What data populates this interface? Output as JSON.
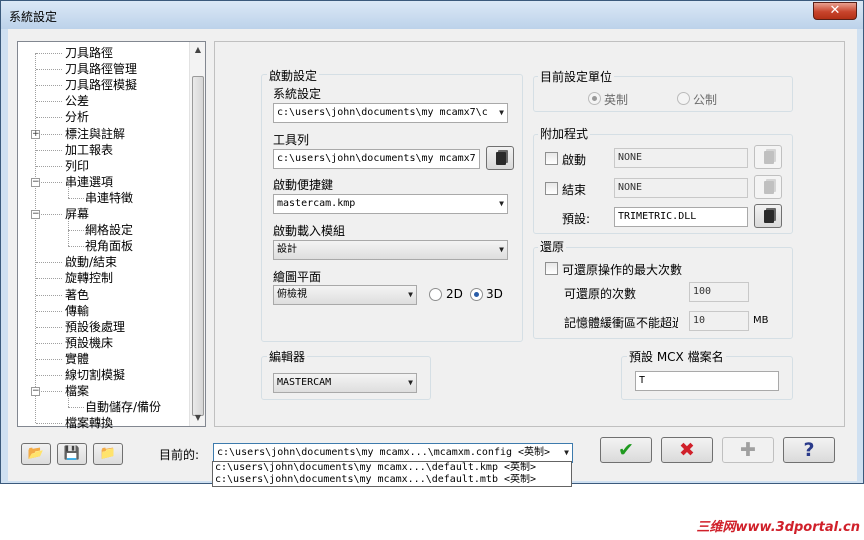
{
  "window": {
    "title": "系統設定",
    "close_glyph": "✕"
  },
  "tree": {
    "items": [
      {
        "label": "刀具路徑",
        "level": 0
      },
      {
        "label": "刀具路徑管理",
        "level": 0
      },
      {
        "label": "刀具路徑模擬",
        "level": 0
      },
      {
        "label": "公差",
        "level": 0
      },
      {
        "label": "分析",
        "level": 0
      },
      {
        "label": "標注與註解",
        "level": 0,
        "expander": "+"
      },
      {
        "label": "加工報表",
        "level": 0
      },
      {
        "label": "列印",
        "level": 0
      },
      {
        "label": "串連選項",
        "level": 0,
        "expander": "−"
      },
      {
        "label": "串連特徵",
        "level": 1
      },
      {
        "label": "屏幕",
        "level": 0,
        "expander": "−"
      },
      {
        "label": "網格設定",
        "level": 1
      },
      {
        "label": "視角面板",
        "level": 1
      },
      {
        "label": "啟動/結束",
        "level": 0
      },
      {
        "label": "旋轉控制",
        "level": 0
      },
      {
        "label": "著色",
        "level": 0
      },
      {
        "label": "傳輸",
        "level": 0
      },
      {
        "label": "預設後處理",
        "level": 0
      },
      {
        "label": "預設機床",
        "level": 0
      },
      {
        "label": "實體",
        "level": 0
      },
      {
        "label": "線切割模擬",
        "level": 0
      },
      {
        "label": "檔案",
        "level": 0,
        "expander": "−"
      },
      {
        "label": "自動儲存/備份",
        "level": 1
      },
      {
        "label": "檔案轉換",
        "level": 0
      }
    ]
  },
  "startup": {
    "group_title": "啟動設定",
    "system_label": "系統設定",
    "system_value": "c:\\users\\john\\documents\\my mcamx7\\c",
    "toolbar_label": "工具列",
    "toolbar_value": "c:\\users\\john\\documents\\my mcamx7",
    "shortcut_label": "啟動便捷鍵",
    "shortcut_value": "mastercam.kmp",
    "module_label": "啟動載入模組",
    "module_value": "設計",
    "plane_label": "繪圖平面",
    "plane_value": "俯檢視",
    "radio_2d": "2D",
    "radio_3d": "3D"
  },
  "units": {
    "group_title": "目前設定單位",
    "imperial": "英制",
    "metric": "公制"
  },
  "addons": {
    "group_title": "附加程式",
    "startup_label": "啟動",
    "startup_value": "NONE",
    "exit_label": "結束",
    "exit_value": "NONE",
    "default_label": "預設:",
    "default_value": "TRIMETRIC.DLL"
  },
  "undo": {
    "group_title": "還原",
    "max_label": "可還原操作的最大次數",
    "count_label": "可還原的次數",
    "count_value": "100",
    "memory_label": "記憶體緩衝區不能超過",
    "memory_value": "10",
    "memory_unit": "MB"
  },
  "editor": {
    "group_title": "編輯器",
    "value": "MASTERCAM"
  },
  "mcx": {
    "group_title": "預設 MCX 檔案名",
    "value": "T"
  },
  "bottom": {
    "current_label": "目前的:",
    "current_value": "c:\\users\\john\\documents\\my mcamx...\\mcamxm.config <英制>",
    "list": [
      "c:\\users\\john\\documents\\my mcamx...\\default.kmp <英制>",
      "c:\\users\\john\\documents\\my mcamx...\\default.mtb <英制>"
    ],
    "ok_glyph": "✔",
    "cancel_glyph": "✖",
    "add_glyph": "✚",
    "help_glyph": "?"
  },
  "watermark": "三维网www.3dportal.cn",
  "colors": {
    "ok": "#1f9a1f",
    "cancel": "#d0202a",
    "watermark": "#d0202a"
  }
}
